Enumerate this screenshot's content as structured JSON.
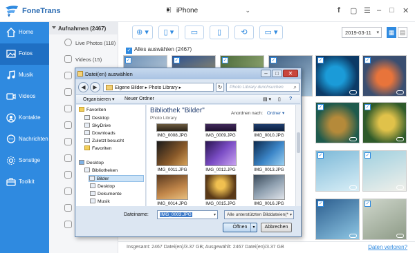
{
  "app": {
    "name": "FoneTrans",
    "device": "iPhone",
    "window_controls": [
      "f",
      "chat",
      "menu",
      "minimize",
      "maximize",
      "close"
    ]
  },
  "sidebar": {
    "items": [
      {
        "label": "Home",
        "icon": "home-icon",
        "active": false
      },
      {
        "label": "Fotos",
        "icon": "photo-icon",
        "active": true
      },
      {
        "label": "Musik",
        "icon": "music-icon",
        "active": false
      },
      {
        "label": "Videos",
        "icon": "video-icon",
        "active": false
      },
      {
        "label": "Kontakte",
        "icon": "contacts-icon",
        "active": false
      },
      {
        "label": "Nachrichten",
        "icon": "message-icon",
        "active": false
      },
      {
        "label": "Sonstige",
        "icon": "other-icon",
        "active": false
      },
      {
        "label": "Toolkit",
        "icon": "toolkit-icon",
        "active": false
      }
    ]
  },
  "albums": {
    "header": "Aufnahmen (2467)",
    "items": [
      "Live Photos (118)",
      "Videos (15)"
    ]
  },
  "toolbar": {
    "date": "2019-03-11",
    "select_all_label": "Alles auswählen (2467)"
  },
  "statusbar": {
    "stats": "Insgesamt: 2467 Datei(en)/3.37 GB; Ausgewählt: 2467 Datei(en)/3.37 GB",
    "lost_link": "Daten verloren?"
  },
  "dialog": {
    "title": "Datei(en) auswählen",
    "address": "Eigene Bilder ▸ Photo Library ▸",
    "search_placeholder": "Photo Library durchsuchen",
    "commands": {
      "organize": "Organisieren ▾",
      "new_folder": "Neuer Ordner"
    },
    "nav_tree": [
      {
        "label": "Favoriten",
        "level": 0,
        "selected": false
      },
      {
        "label": "Desktop",
        "level": 1,
        "selected": false
      },
      {
        "label": "SkyDrive",
        "level": 1,
        "selected": false
      },
      {
        "label": "Downloads",
        "level": 1,
        "selected": false
      },
      {
        "label": "Zuletzt besucht",
        "level": 1,
        "selected": false
      },
      {
        "label": "Favoriten",
        "level": 1,
        "selected": false
      },
      {
        "label": "Desktop",
        "level": 0,
        "selected": false
      },
      {
        "label": "Bibliotheken",
        "level": 1,
        "selected": false
      },
      {
        "label": "Bilder",
        "level": 2,
        "selected": true
      },
      {
        "label": "Desktop",
        "level": 2,
        "selected": false
      },
      {
        "label": "Dokumente",
        "level": 2,
        "selected": false
      },
      {
        "label": "Musik",
        "level": 2,
        "selected": false
      }
    ],
    "library_title": "Bibliothek \"Bilder\"",
    "library_subtitle": "Photo Library",
    "arrange_label": "Anordnen nach:",
    "arrange_value": "Ordner ▾",
    "files": [
      "IMG_0008.JPG",
      "IMG_0009.JPG",
      "IMG_0010.JPG",
      "IMG_0011.JPG",
      "IMG_0012.JPG",
      "IMG_0013.JPG",
      "IMG_0014.JPG",
      "IMG_0015.JPG",
      "IMG_0016.JPG"
    ],
    "filename_label": "Dateiname:",
    "filename_value": "IMG_0003.JPG",
    "filter_value": "Alle unterstützten Bilddateien(*",
    "open_label": "Öffnen",
    "cancel_label": "Abbrechen"
  }
}
